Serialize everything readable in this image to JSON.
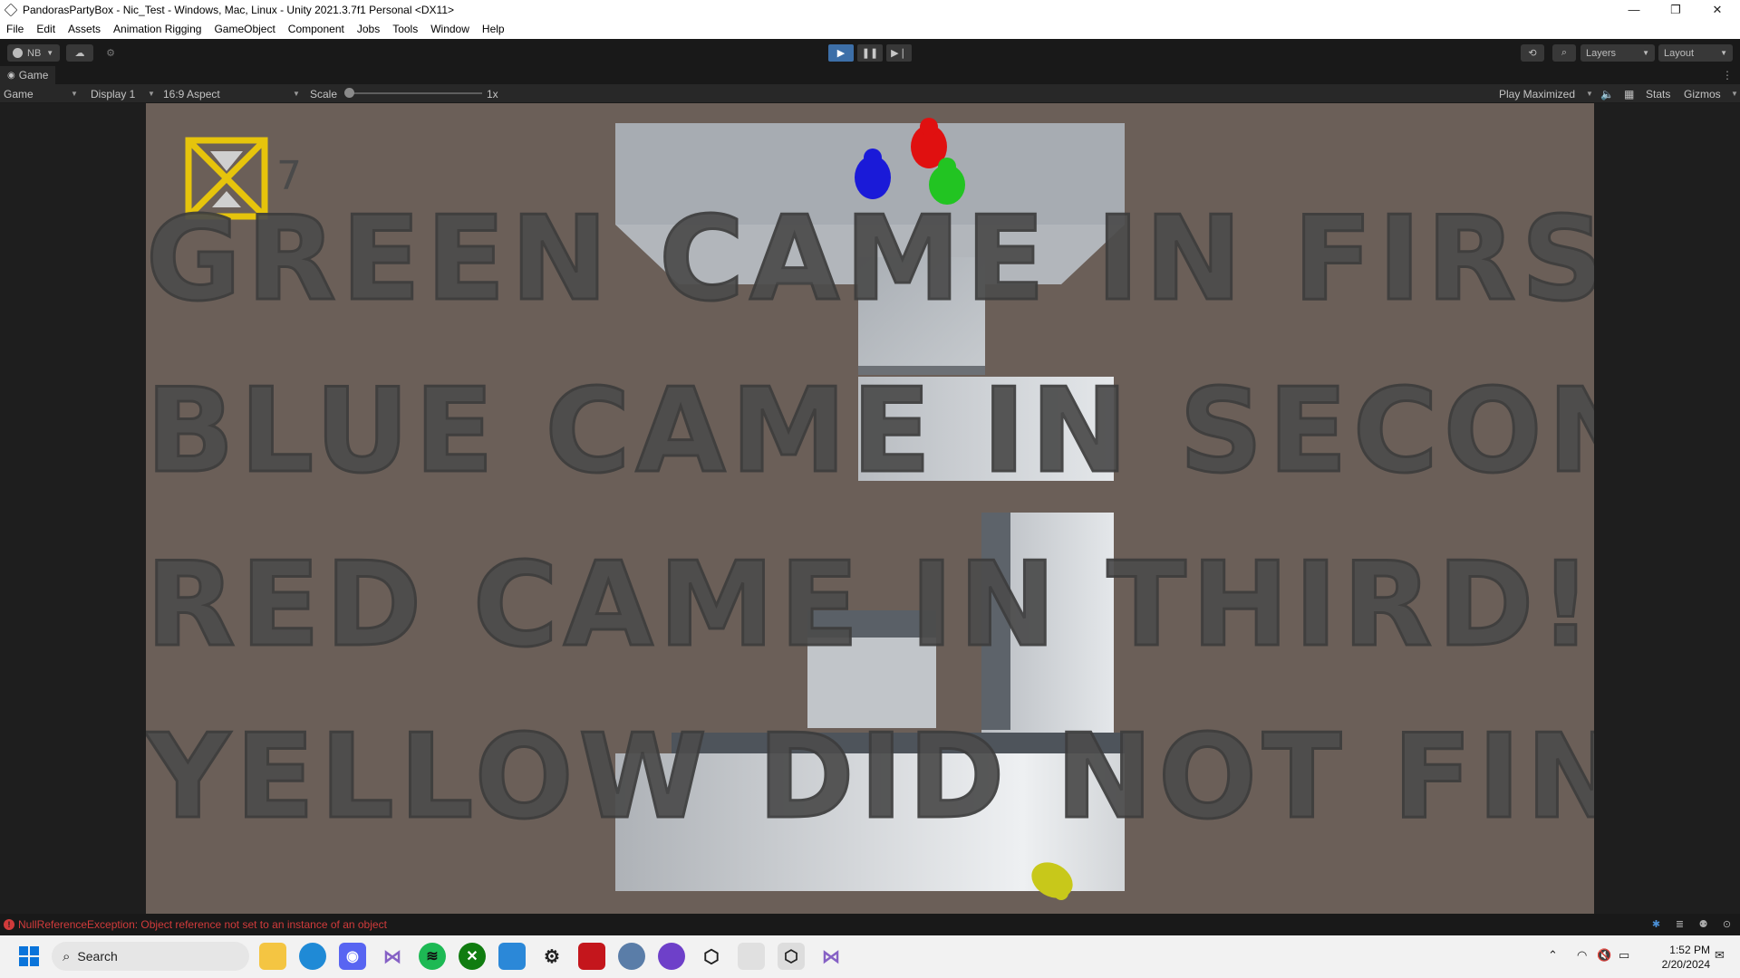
{
  "window": {
    "title": "PandorasPartyBox - Nic_Test - Windows, Mac, Linux - Unity 2021.3.7f1 Personal <DX11>",
    "minimize": "—",
    "maximize": "❐",
    "close": "✕"
  },
  "menu": [
    "File",
    "Edit",
    "Assets",
    "Animation Rigging",
    "GameObject",
    "Component",
    "Jobs",
    "Tools",
    "Window",
    "Help"
  ],
  "toolbar": {
    "account": "NB",
    "layers": "Layers",
    "layout": "Layout"
  },
  "tab": {
    "label": "Game"
  },
  "gamebar": {
    "mode": "Game",
    "display": "Display 1",
    "aspect": "16:9 Aspect",
    "scale_label": "Scale",
    "scale_value": "1x",
    "play_mode": "Play Maximized",
    "stats": "Stats",
    "gizmos": "Gizmos"
  },
  "game": {
    "timer": "7",
    "results": [
      "GREEN CAME IN FIRST!",
      "BLUE CAME IN SECOND!",
      "RED CAME IN THIRD!",
      "YELLOW DID NOT FINISH..."
    ],
    "player_colors": {
      "red": "#e01010",
      "blue": "#1a1ad8",
      "green": "#22c422",
      "yellow": "#c8c81a"
    }
  },
  "console": {
    "error": "NullReferenceException: Object reference not set to an instance of an object"
  },
  "taskbar": {
    "search": "Search",
    "time": "1:52 PM",
    "date": "2/20/2024"
  }
}
